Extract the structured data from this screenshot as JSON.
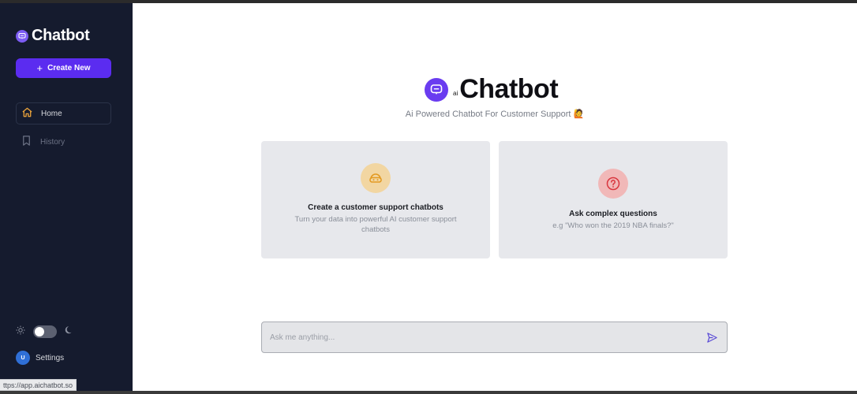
{
  "sidebar": {
    "brand": "Chatbot",
    "create_new_label": "Create New",
    "nav": [
      {
        "label": "Home",
        "icon": "home-icon",
        "active": true
      },
      {
        "label": "History",
        "icon": "bookmark-icon",
        "active": false
      }
    ],
    "avatar_initial": "U",
    "settings_label": "Settings"
  },
  "main": {
    "hero_ai_tag": "ai",
    "hero_title": "Chatbot",
    "tagline": "Ai Powered Chatbot For Customer Support 🙋",
    "cards": [
      {
        "title": "Create a customer support chatbots",
        "description": "Turn your data into powerful AI customer support chatbots",
        "icon": "headset-icon"
      },
      {
        "title": "Ask complex questions",
        "description": "e.g \"Who won the 2019 NBA finals?\"",
        "icon": "question-icon"
      }
    ],
    "input_placeholder": "Ask me anything..."
  },
  "status_url": "ttps://app.aichatbot.so",
  "colors": {
    "sidebar_bg": "#151b2e",
    "accent": "#5b2cf0",
    "card_bg": "#e7e8ec"
  }
}
